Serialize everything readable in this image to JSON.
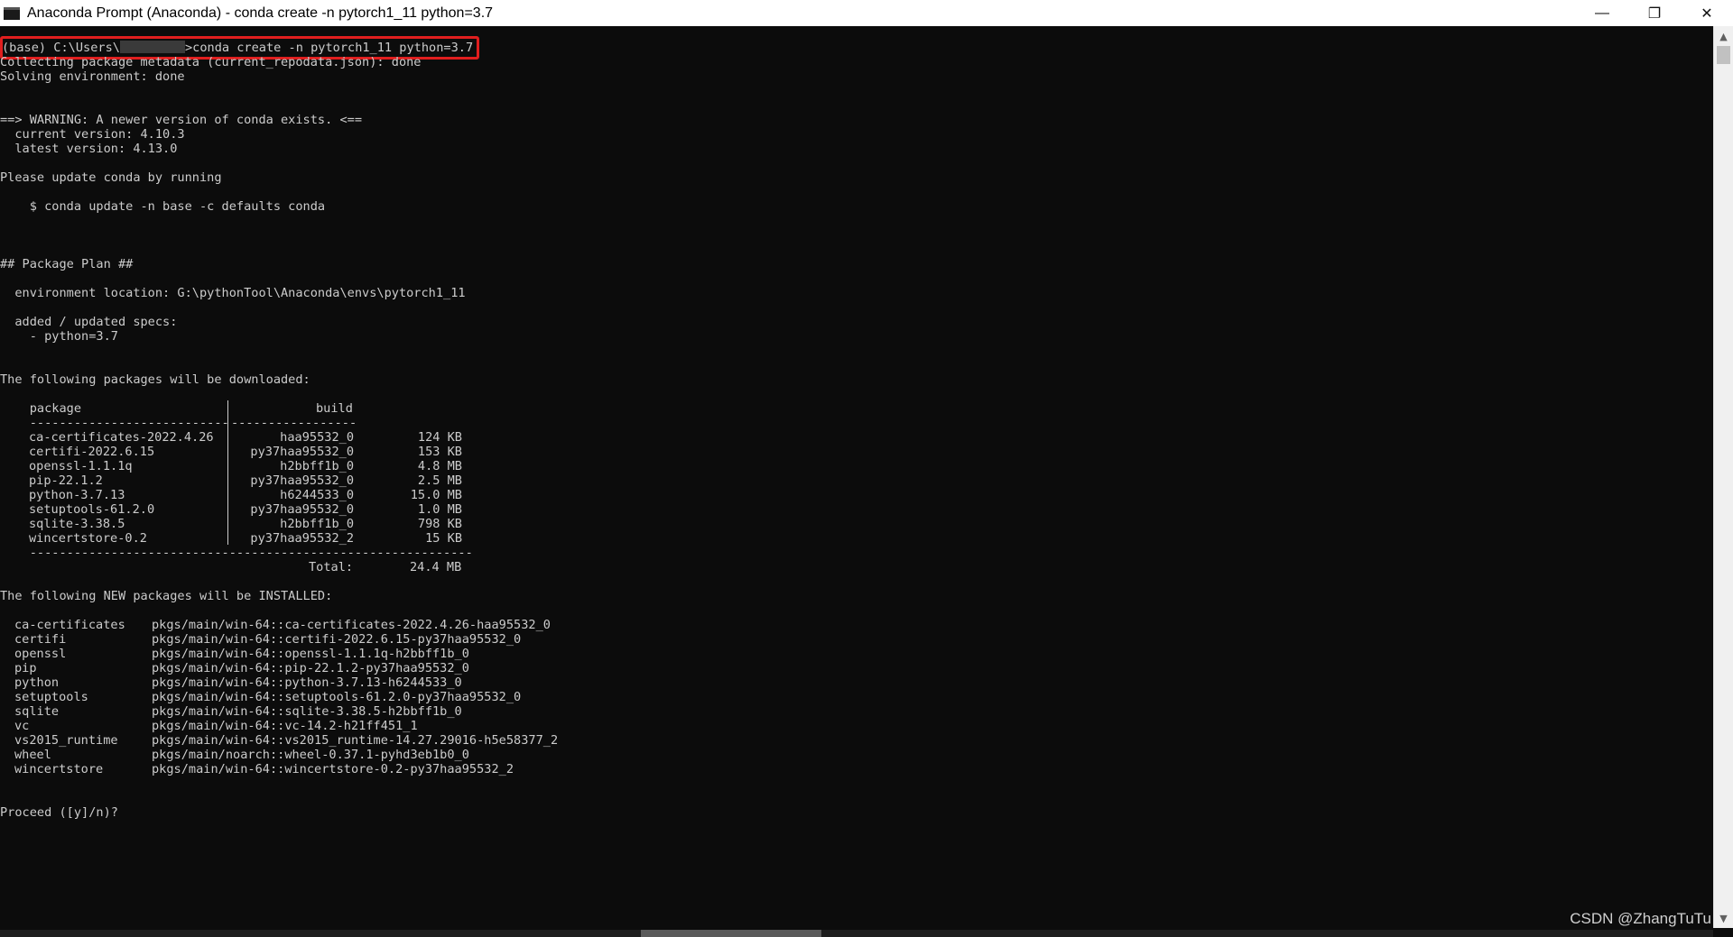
{
  "window": {
    "title": "Anaconda Prompt (Anaconda) - conda  create -n pytorch1_11 python=3.7",
    "minimize": "—",
    "restore": "❐",
    "close": "✕"
  },
  "console": {
    "prompt_prefix": "(base) C:\\Users\\",
    "prompt_command": ">conda create -n pytorch1_11 python=3.7",
    "collecting": "Collecting package metadata (current_repodata.json): done",
    "solving": "Solving environment: done",
    "warning": "==> WARNING: A newer version of conda exists. <==",
    "current_version": "  current version: 4.10.3",
    "latest_version": "  latest version: 4.13.0",
    "update_msg": "Please update conda by running",
    "update_cmd": "    $ conda update -n base -c defaults conda",
    "plan_header": "## Package Plan ##",
    "env_location": "  environment location: G:\\pythonTool\\Anaconda\\envs\\pytorch1_11",
    "specs_header": "  added / updated specs:",
    "spec_python": "    - python=3.7",
    "download_header": "The following packages will be downloaded:",
    "table_header_package": "    package",
    "table_header_build": "build",
    "table_rule_left": "    ---------------------------",
    "table_rule_right": "-----------------",
    "downloads": [
      {
        "package": "ca-certificates-2022.4.26",
        "build": "haa95532_0",
        "size": "124 KB"
      },
      {
        "package": "certifi-2022.6.15",
        "build": "py37haa95532_0",
        "size": "153 KB"
      },
      {
        "package": "openssl-1.1.1q",
        "build": "h2bbff1b_0",
        "size": "4.8 MB"
      },
      {
        "package": "pip-22.1.2",
        "build": "py37haa95532_0",
        "size": "2.5 MB"
      },
      {
        "package": "python-3.7.13",
        "build": "h6244533_0",
        "size": "15.0 MB"
      },
      {
        "package": "setuptools-61.2.0",
        "build": "py37haa95532_0",
        "size": "1.0 MB"
      },
      {
        "package": "sqlite-3.38.5",
        "build": "h2bbff1b_0",
        "size": "798 KB"
      },
      {
        "package": "wincertstore-0.2",
        "build": "py37haa95532_2",
        "size": "15 KB"
      }
    ],
    "table_rule_bottom": "    ------------------------------------------------------------",
    "total_label": "Total:",
    "total_value": "24.4 MB",
    "install_header": "The following NEW packages will be INSTALLED:",
    "installs": [
      {
        "name": "ca-certificates",
        "spec": "pkgs/main/win-64::ca-certificates-2022.4.26-haa95532_0"
      },
      {
        "name": "certifi",
        "spec": "pkgs/main/win-64::certifi-2022.6.15-py37haa95532_0"
      },
      {
        "name": "openssl",
        "spec": "pkgs/main/win-64::openssl-1.1.1q-h2bbff1b_0"
      },
      {
        "name": "pip",
        "spec": "pkgs/main/win-64::pip-22.1.2-py37haa95532_0"
      },
      {
        "name": "python",
        "spec": "pkgs/main/win-64::python-3.7.13-h6244533_0"
      },
      {
        "name": "setuptools",
        "spec": "pkgs/main/win-64::setuptools-61.2.0-py37haa95532_0"
      },
      {
        "name": "sqlite",
        "spec": "pkgs/main/win-64::sqlite-3.38.5-h2bbff1b_0"
      },
      {
        "name": "vc",
        "spec": "pkgs/main/win-64::vc-14.2-h21ff451_1"
      },
      {
        "name": "vs2015_runtime",
        "spec": "pkgs/main/win-64::vs2015_runtime-14.27.29016-h5e58377_2"
      },
      {
        "name": "wheel",
        "spec": "pkgs/main/noarch::wheel-0.37.1-pyhd3eb1b0_0"
      },
      {
        "name": "wincertstore",
        "spec": "pkgs/main/win-64::wincertstore-0.2-py37haa95532_2"
      }
    ],
    "proceed": "Proceed ([y]/n)?"
  },
  "scrollbar": {
    "up_arrow": "▲",
    "down_arrow": "▼"
  },
  "watermark": "CSDN @ZhangTuTu",
  "colors": {
    "console_bg": "#0c0c0c",
    "console_text": "#cccccc",
    "highlight_border": "#e01e1e",
    "titlebar_bg": "#ffffff"
  }
}
